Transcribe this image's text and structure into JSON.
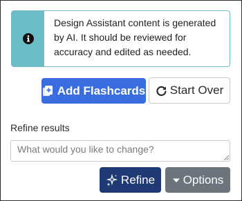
{
  "alert": {
    "icon": "info-circle-icon",
    "message": "Design Assistant content is generated by AI. It should be reviewed for accuracy and edited as needed."
  },
  "actions": {
    "add_flashcards_label": "Add Flashcards",
    "add_flashcards_icon": "flashcards-plus-icon",
    "start_over_label": "Start Over",
    "start_over_icon": "rotate-right-icon"
  },
  "refine": {
    "label": "Refine results",
    "placeholder": "What would you like to change?",
    "value": "",
    "refine_button_label": "Refine",
    "refine_button_icon": "sparkles-icon",
    "options_button_label": "Options",
    "options_button_icon": "caret-down-icon"
  },
  "colors": {
    "alert_accent": "#6bbcc9",
    "primary": "#3a6ee0",
    "refine_button": "#1f3a75",
    "options_button": "#6c757d"
  }
}
